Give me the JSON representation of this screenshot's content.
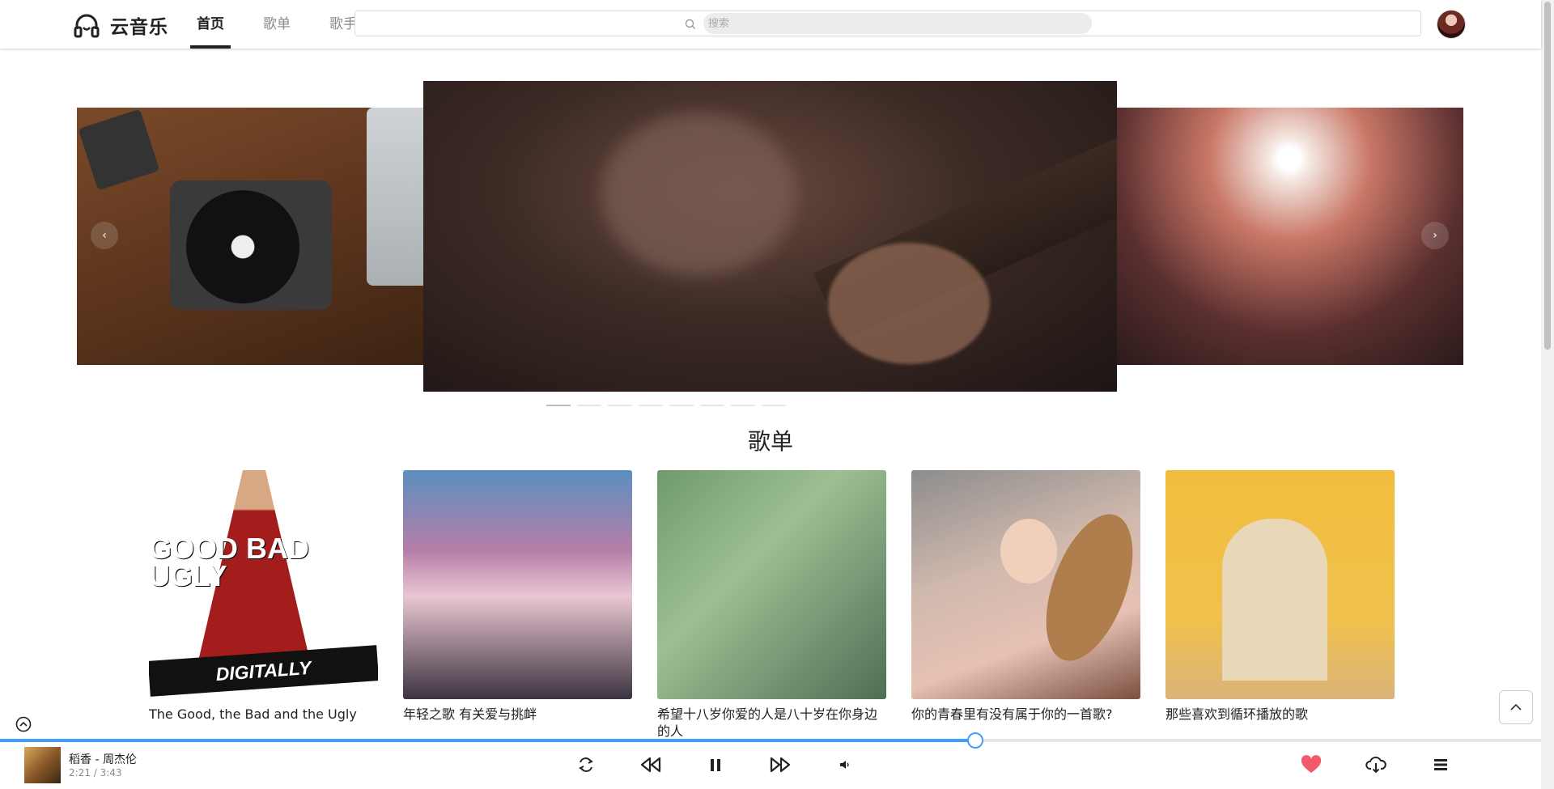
{
  "header": {
    "app_name": "云音乐",
    "nav": [
      {
        "label": "首页",
        "active": true
      },
      {
        "label": "歌单",
        "active": false
      },
      {
        "label": "歌手",
        "active": false
      }
    ],
    "search_placeholder": "搜索"
  },
  "carousel": {
    "slide_count": 8,
    "active_index": 0,
    "prev_icon": "chevron-left-icon",
    "next_icon": "chevron-right-icon"
  },
  "playlists_section": {
    "title": "歌单",
    "items": [
      {
        "title": "The Good, the Bad and the Ugly",
        "cover_text": "GOOD BAD UGLY",
        "cover_banner": "DIGITALLY REMASTERED"
      },
      {
        "title": "年轻之歌 有关爱与挑衅"
      },
      {
        "title": "希望十八岁你爱的人是八十岁在你身边的人"
      },
      {
        "title": "你的青春里有没有属于你的一首歌?"
      },
      {
        "title": "那些喜欢到循环播放的歌"
      }
    ]
  },
  "player": {
    "song": "稻香 - 周杰伦",
    "time": "2:21 / 3:43",
    "progress": 0.633
  },
  "colors": {
    "accent": "#409eff",
    "heart": "#f25a6a"
  },
  "icons": {
    "logo": "headphones-icon",
    "search": "search-icon",
    "loop": "loop-icon",
    "prev": "rewind-icon",
    "pause": "pause-icon",
    "next": "fast-forward-icon",
    "volume": "volume-icon",
    "like": "heart-icon",
    "download": "cloud-download-icon",
    "playlist": "list-icon",
    "back_top": "chevron-up-icon",
    "collapse": "circle-chevron-up-icon"
  }
}
